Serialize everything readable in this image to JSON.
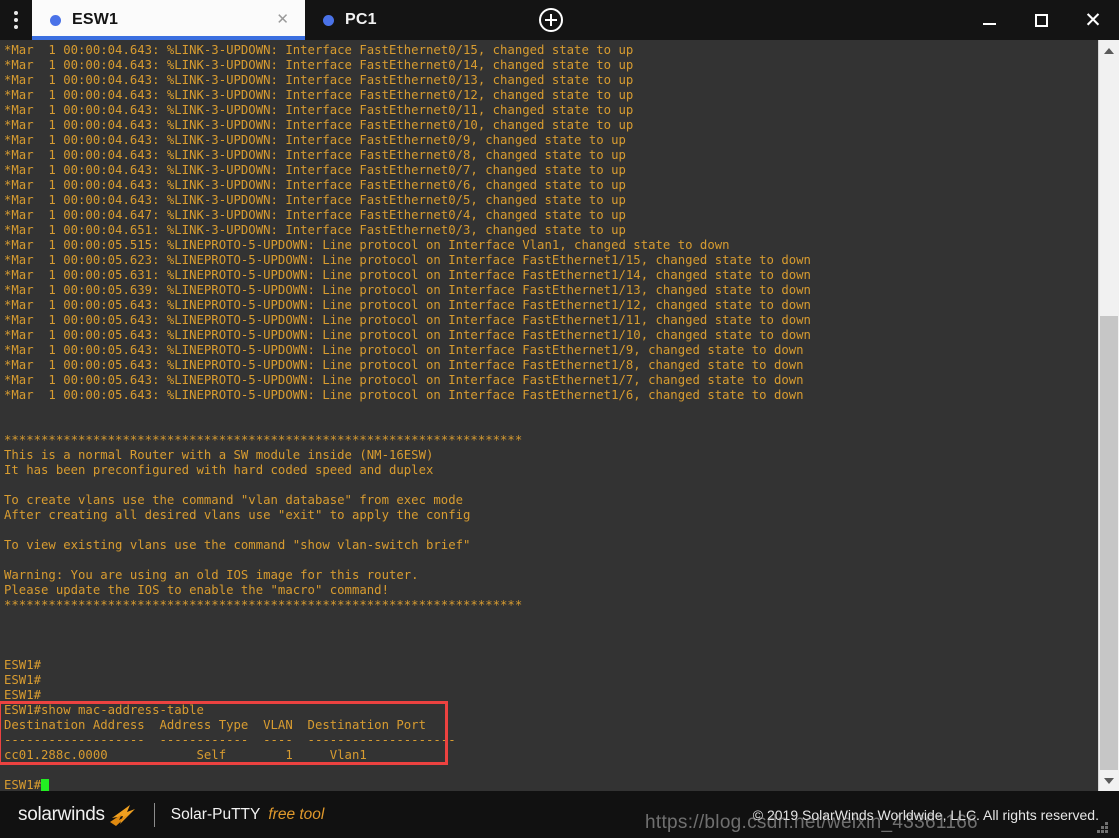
{
  "window": {
    "menu_icon": "kebab-menu-icon",
    "minimize_label": "",
    "maximize_label": "",
    "close_label": "✕"
  },
  "tabs": [
    {
      "label": "ESW1",
      "active": true,
      "status_dot_color": "#4a72e8",
      "close_label": "✕"
    },
    {
      "label": "PC1",
      "active": false,
      "status_dot_color": "#4a72e8",
      "close_label": ""
    }
  ],
  "tabbar": {
    "add_tab_label": "+"
  },
  "terminal": {
    "background": "#333333",
    "text_color": "#d89c30",
    "cursor_color": "#22ee22",
    "highlight_border_color": "#ec4240",
    "lines": [
      "*Mar  1 00:00:04.643: %LINK-3-UPDOWN: Interface FastEthernet0/15, changed state to up",
      "*Mar  1 00:00:04.643: %LINK-3-UPDOWN: Interface FastEthernet0/14, changed state to up",
      "*Mar  1 00:00:04.643: %LINK-3-UPDOWN: Interface FastEthernet0/13, changed state to up",
      "*Mar  1 00:00:04.643: %LINK-3-UPDOWN: Interface FastEthernet0/12, changed state to up",
      "*Mar  1 00:00:04.643: %LINK-3-UPDOWN: Interface FastEthernet0/11, changed state to up",
      "*Mar  1 00:00:04.643: %LINK-3-UPDOWN: Interface FastEthernet0/10, changed state to up",
      "*Mar  1 00:00:04.643: %LINK-3-UPDOWN: Interface FastEthernet0/9, changed state to up",
      "*Mar  1 00:00:04.643: %LINK-3-UPDOWN: Interface FastEthernet0/8, changed state to up",
      "*Mar  1 00:00:04.643: %LINK-3-UPDOWN: Interface FastEthernet0/7, changed state to up",
      "*Mar  1 00:00:04.643: %LINK-3-UPDOWN: Interface FastEthernet0/6, changed state to up",
      "*Mar  1 00:00:04.643: %LINK-3-UPDOWN: Interface FastEthernet0/5, changed state to up",
      "*Mar  1 00:00:04.647: %LINK-3-UPDOWN: Interface FastEthernet0/4, changed state to up",
      "*Mar  1 00:00:04.651: %LINK-3-UPDOWN: Interface FastEthernet0/3, changed state to up",
      "*Mar  1 00:00:05.515: %LINEPROTO-5-UPDOWN: Line protocol on Interface Vlan1, changed state to down",
      "*Mar  1 00:00:05.623: %LINEPROTO-5-UPDOWN: Line protocol on Interface FastEthernet1/15, changed state to down",
      "*Mar  1 00:00:05.631: %LINEPROTO-5-UPDOWN: Line protocol on Interface FastEthernet1/14, changed state to down",
      "*Mar  1 00:00:05.639: %LINEPROTO-5-UPDOWN: Line protocol on Interface FastEthernet1/13, changed state to down",
      "*Mar  1 00:00:05.643: %LINEPROTO-5-UPDOWN: Line protocol on Interface FastEthernet1/12, changed state to down",
      "*Mar  1 00:00:05.643: %LINEPROTO-5-UPDOWN: Line protocol on Interface FastEthernet1/11, changed state to down",
      "*Mar  1 00:00:05.643: %LINEPROTO-5-UPDOWN: Line protocol on Interface FastEthernet1/10, changed state to down",
      "*Mar  1 00:00:05.643: %LINEPROTO-5-UPDOWN: Line protocol on Interface FastEthernet1/9, changed state to down",
      "*Mar  1 00:00:05.643: %LINEPROTO-5-UPDOWN: Line protocol on Interface FastEthernet1/8, changed state to down",
      "*Mar  1 00:00:05.643: %LINEPROTO-5-UPDOWN: Line protocol on Interface FastEthernet1/7, changed state to down",
      "*Mar  1 00:00:05.643: %LINEPROTO-5-UPDOWN: Line protocol on Interface FastEthernet1/6, changed state to down",
      "",
      "",
      "**********************************************************************",
      "This is a normal Router with a SW module inside (NM-16ESW)",
      "It has been preconfigured with hard coded speed and duplex",
      "",
      "To create vlans use the command \"vlan database\" from exec mode",
      "After creating all desired vlans use \"exit\" to apply the config",
      "",
      "To view existing vlans use the command \"show vlan-switch brief\"",
      "",
      "Warning: You are using an old IOS image for this router.",
      "Please update the IOS to enable the \"macro\" command!",
      "**********************************************************************",
      "",
      "",
      "",
      "ESW1#",
      "ESW1#",
      "ESW1#",
      "ESW1#show mac-address-table",
      "Destination Address  Address Type  VLAN  Destination Port",
      "-------------------  ------------  ----  --------------------",
      "cc01.288c.0000            Self        1     Vlan1",
      ""
    ],
    "prompt_line": "ESW1#",
    "highlight_start_line": 44,
    "highlight_end_line": 47
  },
  "scrollbar": {
    "up_arrow": "chevron-up-icon",
    "down_arrow": "chevron-down-icon"
  },
  "statusbar": {
    "brand": "solarwinds",
    "product": "Solar-PuTTY",
    "free_tag": "free tool",
    "copyright": "© 2019 SolarWinds Worldwide, LLC. All rights reserved."
  },
  "watermark": {
    "text": "https://blog.csdn.net/weixin_43361166"
  }
}
